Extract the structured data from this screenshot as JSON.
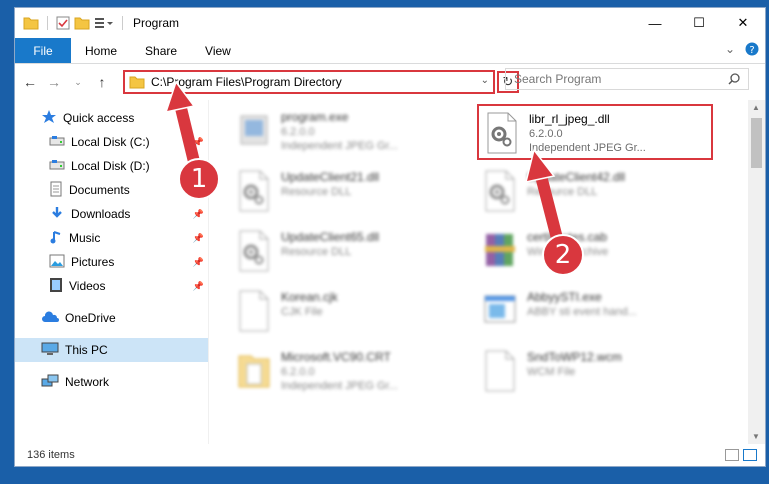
{
  "window": {
    "title": "Program",
    "controls": {
      "minimize": "—",
      "maximize": "☐",
      "close": "✕"
    }
  },
  "ribbon": {
    "file": "File",
    "tabs": [
      "Home",
      "Share",
      "View"
    ]
  },
  "address": {
    "path": "C:\\Program Files\\Program Directory",
    "search_placeholder": "Search Program"
  },
  "sidebar": {
    "items": [
      {
        "label": "Quick access",
        "icon": "star-icon",
        "pinned": false,
        "sub": false
      },
      {
        "label": "Local Disk (C:)",
        "icon": "drive-icon",
        "pinned": true,
        "sub": true
      },
      {
        "label": "Local Disk (D:)",
        "icon": "drive-icon",
        "pinned": false,
        "sub": true
      },
      {
        "label": "Documents",
        "icon": "document-icon",
        "pinned": false,
        "sub": true
      },
      {
        "label": "Downloads",
        "icon": "download-icon",
        "pinned": true,
        "sub": true
      },
      {
        "label": "Music",
        "icon": "music-icon",
        "pinned": true,
        "sub": true
      },
      {
        "label": "Pictures",
        "icon": "picture-icon",
        "pinned": true,
        "sub": true
      },
      {
        "label": "Videos",
        "icon": "video-icon",
        "pinned": true,
        "sub": true
      },
      {
        "label": "OneDrive",
        "icon": "cloud-icon",
        "pinned": false,
        "sub": false
      },
      {
        "label": "This PC",
        "icon": "computer-icon",
        "pinned": false,
        "sub": false,
        "selected": true
      },
      {
        "label": "Network",
        "icon": "network-icon",
        "pinned": false,
        "sub": false
      }
    ]
  },
  "files": [
    {
      "name": "program.exe",
      "line2": "6.2.0.0",
      "line3": "Independent JPEG Gr...",
      "icon": "exe-icon",
      "blurred": true
    },
    {
      "name": "libr_rl_jpeg_.dll",
      "line2": "6.2.0.0",
      "line3": "Independent JPEG Gr...",
      "icon": "dll-gear-icon",
      "blurred": false,
      "highlighted": true
    },
    {
      "name": "UpdateClient21.dll",
      "line2": "Resource DLL",
      "line3": "",
      "icon": "dll-gear-icon",
      "blurred": true
    },
    {
      "name": "UpdateClient42.dll",
      "line2": "Resource DLL",
      "line3": "",
      "icon": "dll-gear-icon",
      "blurred": true
    },
    {
      "name": "UpdateClient65.dll",
      "line2": "Resource DLL",
      "line3": "",
      "icon": "dll-gear-icon",
      "blurred": true
    },
    {
      "name": "certificates.cab",
      "line2": "WinRAR Archive",
      "line3": "",
      "icon": "archive-icon",
      "blurred": true
    },
    {
      "name": "Korean.cjk",
      "line2": "CJK File",
      "line3": "",
      "icon": "file-icon",
      "blurred": true
    },
    {
      "name": "AbbyySTI.exe",
      "line2": "ABBY sti event hand...",
      "line3": "",
      "icon": "exe-window-icon",
      "blurred": true
    },
    {
      "name": "Microsoft.VC90.CRT",
      "line2": "6.2.0.0",
      "line3": "Independent JPEG Gr...",
      "icon": "folder-file-icon",
      "blurred": true
    },
    {
      "name": "SndToWP12.wcm",
      "line2": "WCM File",
      "line3": "",
      "icon": "file-icon",
      "blurred": true
    }
  ],
  "annotations": {
    "step1": "1",
    "step2": "2"
  },
  "status": {
    "count": "136 items"
  },
  "colors": {
    "accent": "#1979ca",
    "highlight": "#d9373e",
    "selected": "#cce4f7"
  }
}
